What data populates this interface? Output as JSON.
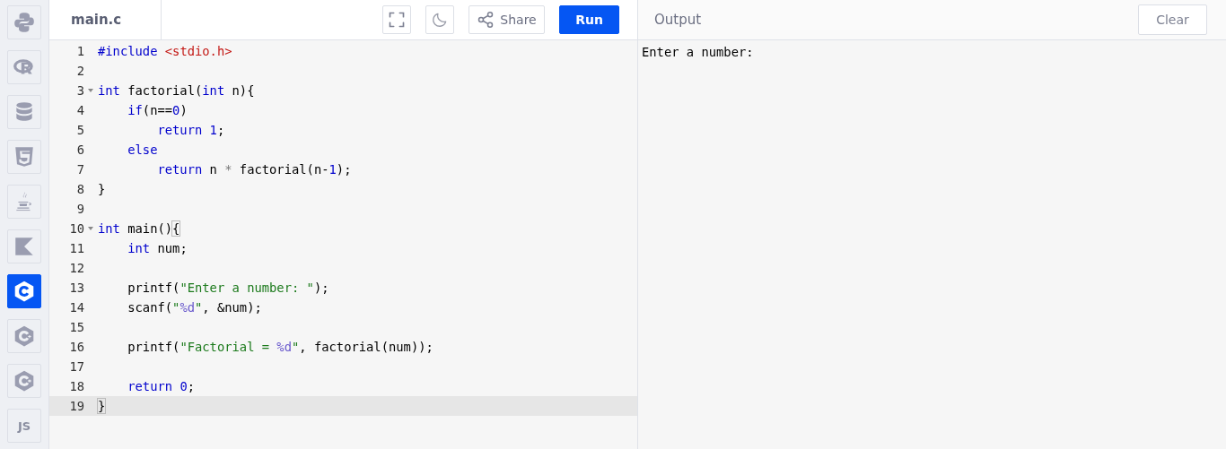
{
  "sidebar": {
    "items": [
      {
        "kind": "python",
        "selected": false
      },
      {
        "kind": "r",
        "selected": false
      },
      {
        "kind": "database",
        "selected": false
      },
      {
        "kind": "html5",
        "selected": false
      },
      {
        "kind": "java",
        "selected": false
      },
      {
        "kind": "kotlin",
        "selected": false
      },
      {
        "kind": "c",
        "selected": true
      },
      {
        "kind": "cpp",
        "selected": false
      },
      {
        "kind": "csharp",
        "selected": false
      },
      {
        "kind": "text",
        "label": "JS",
        "selected": false
      }
    ]
  },
  "editor": {
    "tab": "main.c",
    "toolbar": [
      {
        "kind": "fullscreen"
      },
      {
        "kind": "theme"
      },
      {
        "kind": "share",
        "label": "Share"
      },
      {
        "kind": "run",
        "label": "Run"
      }
    ],
    "lines": [
      {
        "number": "1",
        "foldable": false,
        "active": false,
        "tokens": [
          {
            "kind": "keyword",
            "text": "#include "
          },
          {
            "kind": "include",
            "text": "<stdio.h>"
          }
        ]
      },
      {
        "number": "2",
        "foldable": false,
        "active": false
      },
      {
        "number": "3",
        "foldable": true,
        "active": false,
        "tokens": [
          {
            "kind": "keyword",
            "text": "int"
          },
          {
            "kind": "plain",
            "text": " factorial("
          },
          {
            "kind": "keyword",
            "text": "int"
          },
          {
            "kind": "plain",
            "text": " n){"
          }
        ]
      },
      {
        "number": "4",
        "foldable": false,
        "active": false,
        "tokens": [
          {
            "kind": "keyword",
            "text": "    if"
          },
          {
            "kind": "plain",
            "text": "(n=="
          },
          {
            "kind": "number",
            "text": "0"
          },
          {
            "kind": "plain",
            "text": ")"
          }
        ]
      },
      {
        "number": "5",
        "foldable": false,
        "active": false,
        "tokens": [
          {
            "kind": "keyword",
            "text": "        return "
          },
          {
            "kind": "number",
            "text": "1"
          },
          {
            "kind": "plain",
            "text": ";"
          }
        ]
      },
      {
        "number": "6",
        "foldable": false,
        "active": false,
        "tokens": [
          {
            "kind": "keyword",
            "text": "    else"
          }
        ]
      },
      {
        "number": "7",
        "foldable": false,
        "active": false,
        "tokens": [
          {
            "kind": "keyword",
            "text": "        return"
          },
          {
            "kind": "plain",
            "text": " n "
          },
          {
            "kind": "operator",
            "text": "*"
          },
          {
            "kind": "plain",
            "text": " factorial(n-"
          },
          {
            "kind": "number",
            "text": "1"
          },
          {
            "kind": "plain",
            "text": ");"
          }
        ]
      },
      {
        "number": "8",
        "foldable": false,
        "active": false,
        "tokens": [
          {
            "kind": "plain",
            "text": "}"
          }
        ]
      },
      {
        "number": "9",
        "foldable": false,
        "active": false
      },
      {
        "number": "10",
        "foldable": true,
        "active": false,
        "tokens": [
          {
            "kind": "keyword",
            "text": "int"
          },
          {
            "kind": "plain",
            "text": " main()"
          },
          {
            "kind": "bracket",
            "text": "{"
          }
        ]
      },
      {
        "number": "11",
        "foldable": false,
        "active": false,
        "tokens": [
          {
            "kind": "keyword",
            "text": "    int"
          },
          {
            "kind": "plain",
            "text": " num;"
          }
        ]
      },
      {
        "number": "12",
        "foldable": false,
        "active": false
      },
      {
        "number": "13",
        "foldable": false,
        "active": false,
        "tokens": [
          {
            "kind": "plain",
            "text": "    printf("
          },
          {
            "kind": "string",
            "text": "\"Enter a number: \""
          },
          {
            "kind": "plain",
            "text": ");"
          }
        ]
      },
      {
        "number": "14",
        "foldable": false,
        "active": false,
        "tokens": [
          {
            "kind": "plain",
            "text": "    scanf("
          },
          {
            "kind": "string",
            "text": "\""
          },
          {
            "kind": "format",
            "text": "%d"
          },
          {
            "kind": "string",
            "text": "\""
          },
          {
            "kind": "plain",
            "text": ", &num);"
          }
        ]
      },
      {
        "number": "15",
        "foldable": false,
        "active": false
      },
      {
        "number": "16",
        "foldable": false,
        "active": false,
        "tokens": [
          {
            "kind": "plain",
            "text": "    printf("
          },
          {
            "kind": "string",
            "text": "\"Factorial = "
          },
          {
            "kind": "format",
            "text": "%d"
          },
          {
            "kind": "string",
            "text": "\""
          },
          {
            "kind": "plain",
            "text": ", factorial(num));"
          }
        ]
      },
      {
        "number": "17",
        "foldable": false,
        "active": false
      },
      {
        "number": "18",
        "foldable": false,
        "active": false,
        "tokens": [
          {
            "kind": "keyword",
            "text": "    return "
          },
          {
            "kind": "number",
            "text": "0"
          },
          {
            "kind": "plain",
            "text": ";"
          }
        ]
      },
      {
        "number": "19",
        "foldable": false,
        "active": true,
        "tokens": [
          {
            "kind": "bracket",
            "text": "}"
          }
        ]
      }
    ]
  },
  "output": {
    "title": "Output",
    "clear_button": "Clear",
    "text": "Enter a number:"
  }
}
